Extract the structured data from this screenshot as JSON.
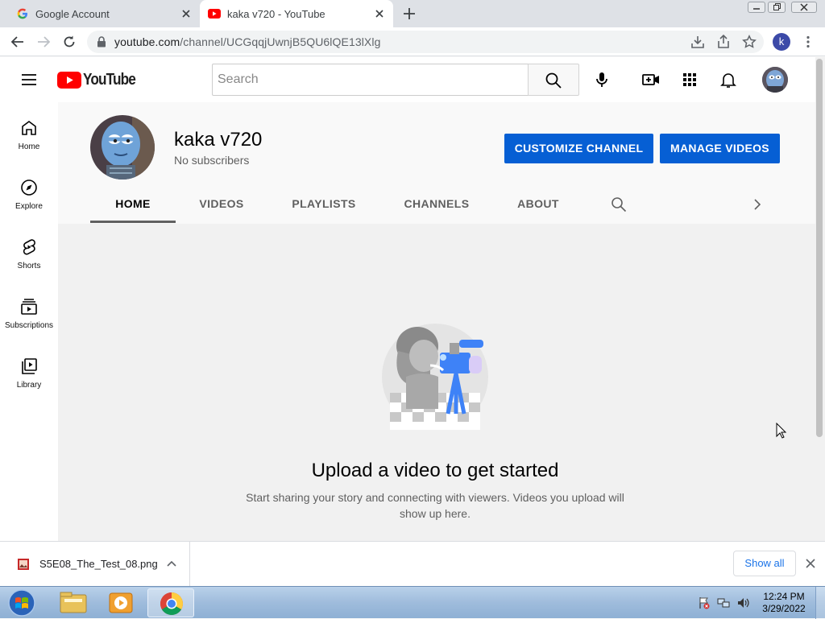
{
  "browser": {
    "tabs": [
      {
        "title": "Google Account"
      },
      {
        "title": "kaka v720 - YouTube"
      }
    ],
    "url_host": "youtube.com",
    "url_path": "/channel/UCGqqjUwnjB5QU6lQE13lXlg",
    "profile_initial": "k"
  },
  "masthead": {
    "logo_text": "YouTube",
    "search_placeholder": "Search"
  },
  "sidebar": {
    "items": [
      {
        "label": "Home"
      },
      {
        "label": "Explore"
      },
      {
        "label": "Shorts"
      },
      {
        "label": "Subscriptions"
      },
      {
        "label": "Library"
      }
    ]
  },
  "channel": {
    "name": "kaka v720",
    "subscribers": "No subscribers",
    "customize_label": "CUSTOMIZE CHANNEL",
    "manage_label": "MANAGE VIDEOS",
    "tabs": [
      "HOME",
      "VIDEOS",
      "PLAYLISTS",
      "CHANNELS",
      "ABOUT"
    ]
  },
  "empty_state": {
    "title": "Upload a video to get started",
    "description": "Start sharing your story and connecting with viewers. Videos you upload will show up here."
  },
  "downloads": {
    "file_name": "S5E08_The_Test_08.png",
    "show_all_label": "Show all"
  },
  "taskbar": {
    "time": "12:24 PM",
    "date": "3/29/2022"
  },
  "colors": {
    "accent_blue": "#065fd4",
    "youtube_red": "#ff0000"
  }
}
